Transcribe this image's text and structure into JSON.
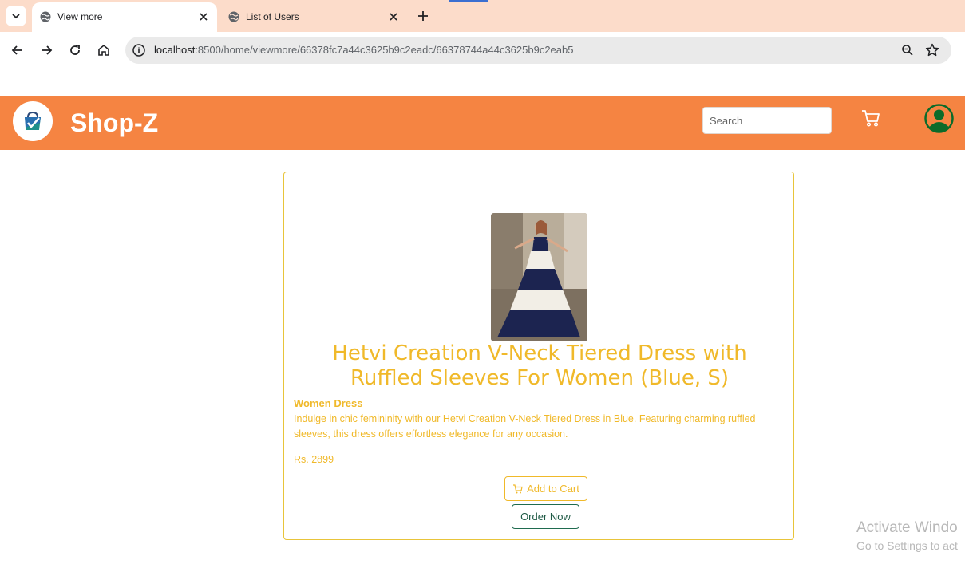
{
  "browser": {
    "tabs": [
      {
        "title": "View more",
        "active": true,
        "icon": "globe-icon"
      },
      {
        "title": "List of Users",
        "active": false,
        "icon": "globe-icon"
      }
    ],
    "url_host": "localhost",
    "url_rest": ":8500/home/viewmore/66378fc7a44c3625b9c2eadc/66378744a44c3625b9c2eab5"
  },
  "header": {
    "brand": "Shop-Z",
    "search_placeholder": "Search",
    "bg_color": "#f58442"
  },
  "product": {
    "title": "Hetvi Creation V-Neck Tiered Dress with Ruffled Sleeves For Women (Blue, S)",
    "category": "Women Dress",
    "description": "Indulge in chic femininity with our Hetvi Creation V-Neck Tiered Dress in Blue. Featuring charming ruffled sleeves, this dress offers effortless elegance for any occasion.",
    "price": "Rs. 2899",
    "add_to_cart_label": "Add to Cart",
    "order_now_label": "Order Now",
    "accent_color": "#f0b92a"
  },
  "watermark": {
    "title": "Activate Windo",
    "subtitle": "Go to Settings to act"
  }
}
